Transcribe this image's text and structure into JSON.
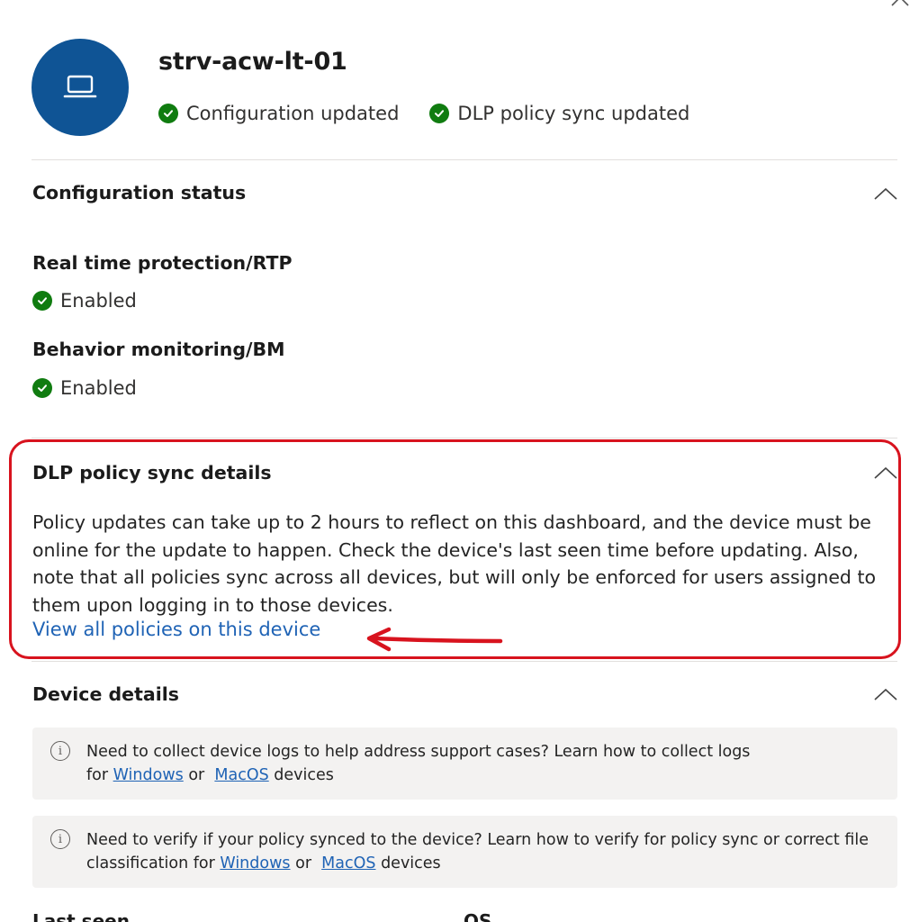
{
  "header": {
    "device_name": "strv-acw-lt-01",
    "statuses": [
      {
        "label": "Configuration updated",
        "icon": "check-circle-icon"
      },
      {
        "label": "DLP policy sync updated",
        "icon": "check-circle-icon"
      }
    ],
    "avatar_icon": "laptop-icon",
    "avatar_color": "#0f5495"
  },
  "configuration_status": {
    "title": "Configuration status",
    "rtp": {
      "label": "Real time protection/RTP",
      "value": "Enabled"
    },
    "bm": {
      "label": "Behavior monitoring/BM",
      "value": "Enabled"
    }
  },
  "dlp_policy_sync": {
    "title": "DLP policy sync details",
    "description": "Policy updates can take up to 2 hours to reflect on this dashboard, and the device must be online for the update to happen. Check the device's last seen time before updating. Also, note that all policies sync across all devices, but will only be enforced for users assigned to them upon logging in to those devices.",
    "link": "View all policies on this device",
    "annotation_color": "#d8131e"
  },
  "device_details": {
    "title": "Device details",
    "info1": {
      "line1": "Need to collect device logs to help address support cases? Learn how to collect logs",
      "prefix": "for",
      "link_windows": "Windows",
      "or": "or",
      "link_macos": "MacOS",
      "suffix": "devices"
    },
    "info2": {
      "line1": "Need to verify if your policy synced to the device? Learn how to verify for policy sync or correct file",
      "prefix": "classification for",
      "link_windows": "Windows",
      "or": "or",
      "link_macos": "MacOS",
      "suffix": "devices"
    },
    "last_seen_label": "Last seen",
    "os_label": "OS"
  },
  "colors": {
    "success": "#107c10",
    "link": "#1f63b5"
  }
}
